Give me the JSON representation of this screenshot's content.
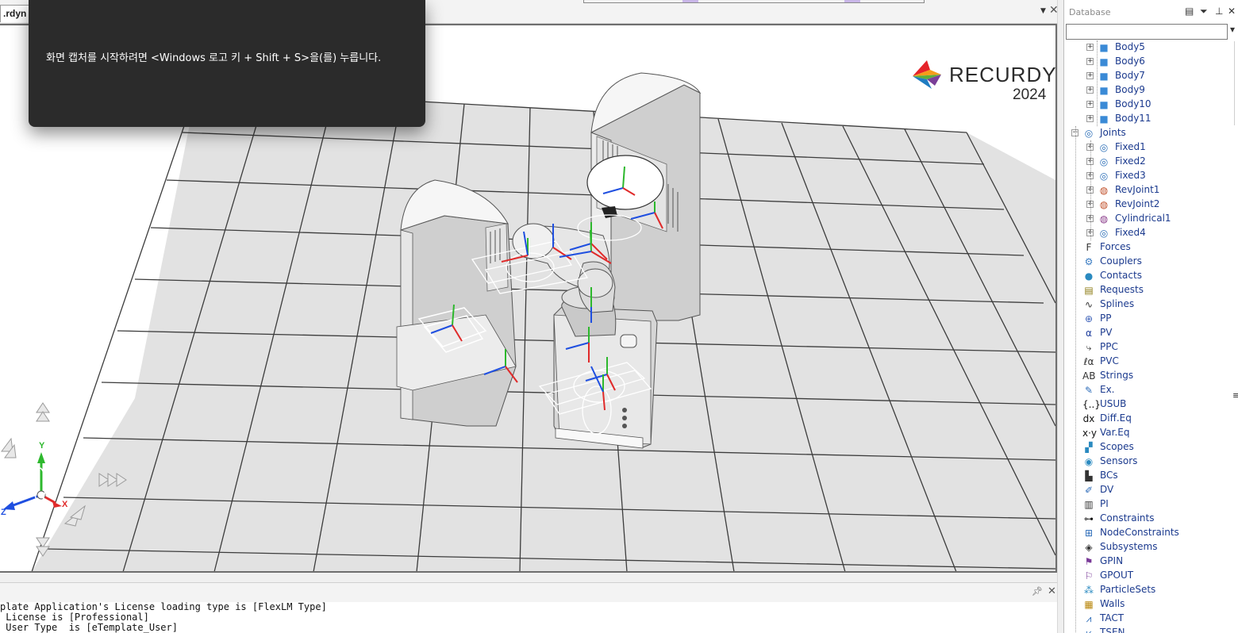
{
  "app": {
    "doc_tab_label": ".rdyn",
    "logo_word": "RECURDYN",
    "logo_year": "2024"
  },
  "toast": {
    "message": "화면 캡처를 시작하려면 <Windows 로고 키 + Shift + S>을(를) 누릅니다."
  },
  "viewport": {
    "triad": {
      "y": "Y",
      "z": "Z",
      "x": "X"
    },
    "background": "#ffffff",
    "floor_color": "#e2e2e2",
    "grid_color": "#3c3c3c"
  },
  "output": {
    "lines": [
      "plate Application's License loading type is [FlexLM Type]",
      " License is [Professional]",
      " User Type  is [eTemplate_User]"
    ]
  },
  "database": {
    "title": "Database",
    "search_value": "",
    "bodies": [
      "Body5",
      "Body6",
      "Body7",
      "Body9",
      "Body10",
      "Body11"
    ],
    "joints_label": "Joints",
    "joints": [
      {
        "label": "Fixed1",
        "icon": "fixed-joint-icon"
      },
      {
        "label": "Fixed2",
        "icon": "fixed-joint-icon"
      },
      {
        "label": "Fixed3",
        "icon": "fixed-joint-icon"
      },
      {
        "label": "RevJoint1",
        "icon": "revolute-joint-icon"
      },
      {
        "label": "RevJoint2",
        "icon": "revolute-joint-icon"
      },
      {
        "label": "Cylindrical1",
        "icon": "cylindrical-joint-icon"
      },
      {
        "label": "Fixed4",
        "icon": "fixed-joint-icon"
      }
    ],
    "categories": [
      {
        "label": "Forces",
        "icon": "forces-icon",
        "glyph": "F"
      },
      {
        "label": "Couplers",
        "icon": "couplers-icon",
        "glyph": "⚙"
      },
      {
        "label": "Contacts",
        "icon": "contacts-icon",
        "glyph": "●"
      },
      {
        "label": "Requests",
        "icon": "requests-icon",
        "glyph": "▤"
      },
      {
        "label": "Splines",
        "icon": "splines-icon",
        "glyph": "∿"
      },
      {
        "label": "PP",
        "icon": "pp-icon",
        "glyph": "⊕"
      },
      {
        "label": "PV",
        "icon": "pv-icon",
        "glyph": "α"
      },
      {
        "label": "PPC",
        "icon": "ppc-icon",
        "glyph": "⤷"
      },
      {
        "label": "PVC",
        "icon": "pvc-icon",
        "glyph": "ℓα"
      },
      {
        "label": "Strings",
        "icon": "strings-icon",
        "glyph": "AB"
      },
      {
        "label": "Ex.",
        "icon": "expression-icon",
        "glyph": "✎"
      },
      {
        "label": "USUB",
        "icon": "usub-icon",
        "glyph": "{..}"
      },
      {
        "label": "Diff.Eq",
        "icon": "diff-eq-icon",
        "glyph": "dx"
      },
      {
        "label": "Var.Eq",
        "icon": "var-eq-icon",
        "glyph": "x·y"
      },
      {
        "label": "Scopes",
        "icon": "scopes-icon",
        "glyph": "▞"
      },
      {
        "label": "Sensors",
        "icon": "sensors-icon",
        "glyph": "◉"
      },
      {
        "label": "BCs",
        "icon": "bcs-icon",
        "glyph": "▙"
      },
      {
        "label": "DV",
        "icon": "dv-icon",
        "glyph": "✐"
      },
      {
        "label": "PI",
        "icon": "pi-icon",
        "glyph": "▥"
      },
      {
        "label": "Constraints",
        "icon": "constraints-icon",
        "glyph": "⊶"
      },
      {
        "label": "NodeConstraints",
        "icon": "node-constraints-icon",
        "glyph": "⊞"
      },
      {
        "label": "Subsystems",
        "icon": "subsystems-icon",
        "glyph": "◈"
      },
      {
        "label": "GPIN",
        "icon": "gpin-icon",
        "glyph": "⚑"
      },
      {
        "label": "GPOUT",
        "icon": "gpout-icon",
        "glyph": "⚐"
      },
      {
        "label": "ParticleSets",
        "icon": "particle-sets-icon",
        "glyph": "⁂"
      },
      {
        "label": "Walls",
        "icon": "walls-icon",
        "glyph": "▦"
      },
      {
        "label": "TACT",
        "icon": "tact-icon",
        "glyph": "⩘"
      },
      {
        "label": "TSEN",
        "icon": "tsen-icon",
        "glyph": "⩗"
      }
    ]
  }
}
